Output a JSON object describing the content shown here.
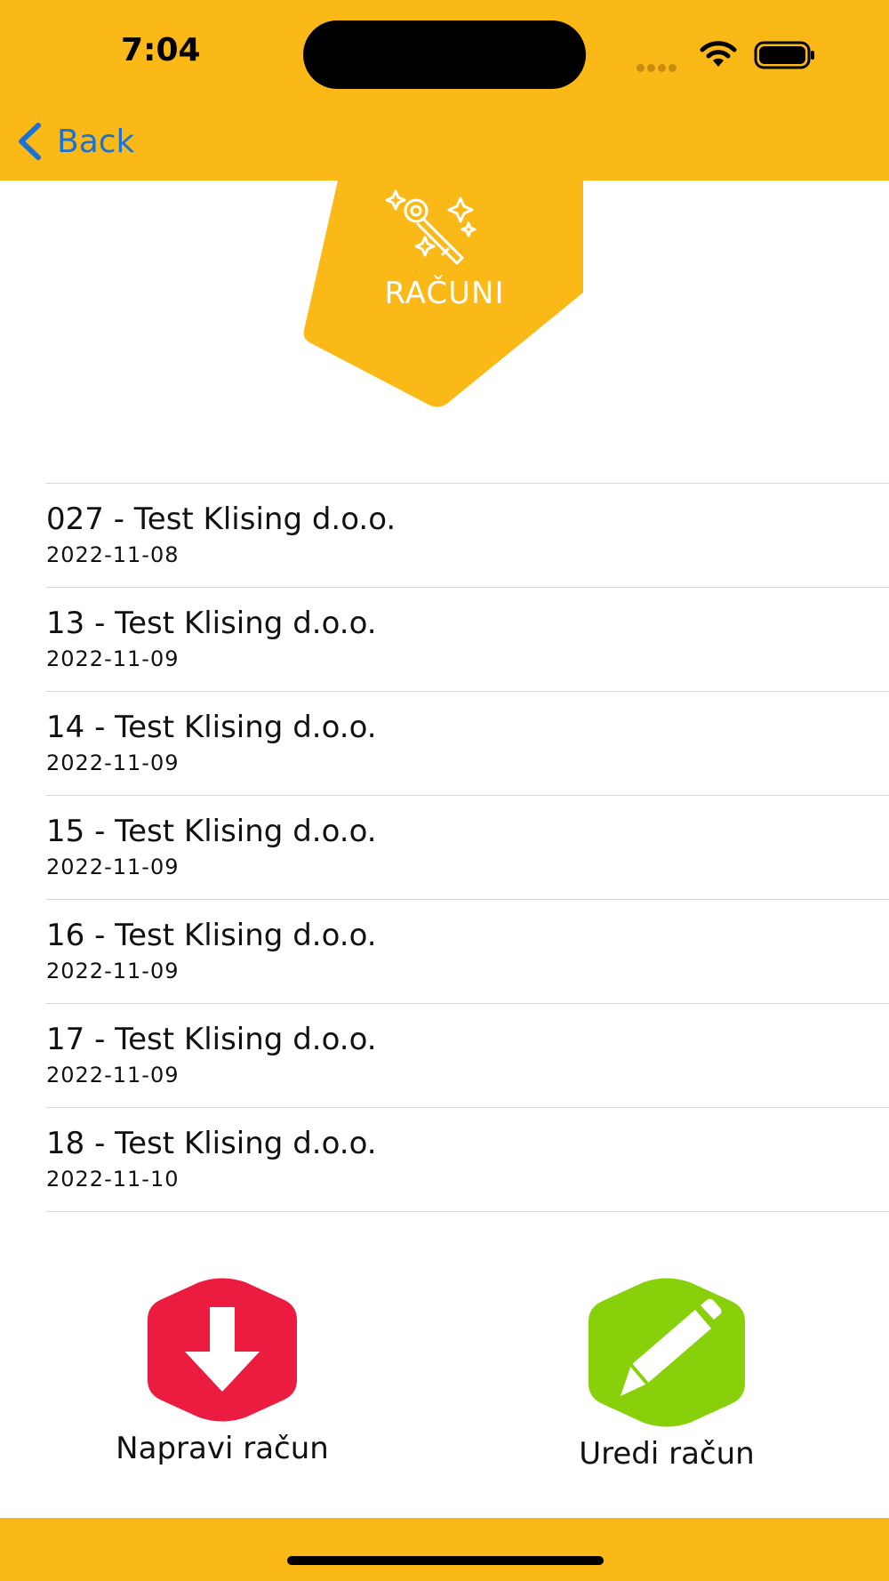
{
  "status_bar": {
    "time": "7:04"
  },
  "nav": {
    "back_label": "Back",
    "accent": "#1a72d6"
  },
  "badge": {
    "title": "RAČUNI",
    "icon": "magic-wand-icon",
    "color": "#fbb917"
  },
  "invoices": [
    {
      "title": "027 - Test Klising d.o.o.",
      "date": "2022-11-08"
    },
    {
      "title": "13 - Test Klising d.o.o.",
      "date": "2022-11-09"
    },
    {
      "title": "14 - Test Klising d.o.o.",
      "date": "2022-11-09"
    },
    {
      "title": "15 - Test Klising d.o.o.",
      "date": "2022-11-09"
    },
    {
      "title": "16 - Test Klising d.o.o.",
      "date": "2022-11-09"
    },
    {
      "title": "17 - Test Klising d.o.o.",
      "date": "2022-11-09"
    },
    {
      "title": "18 - Test Klising d.o.o.",
      "date": "2022-11-10"
    }
  ],
  "actions": {
    "create": {
      "label": "Napravi račun",
      "icon": "download-arrow-icon",
      "color": "#ec1c40"
    },
    "edit": {
      "label": "Uredi račun",
      "icon": "pencil-icon",
      "color": "#88d10a"
    }
  }
}
